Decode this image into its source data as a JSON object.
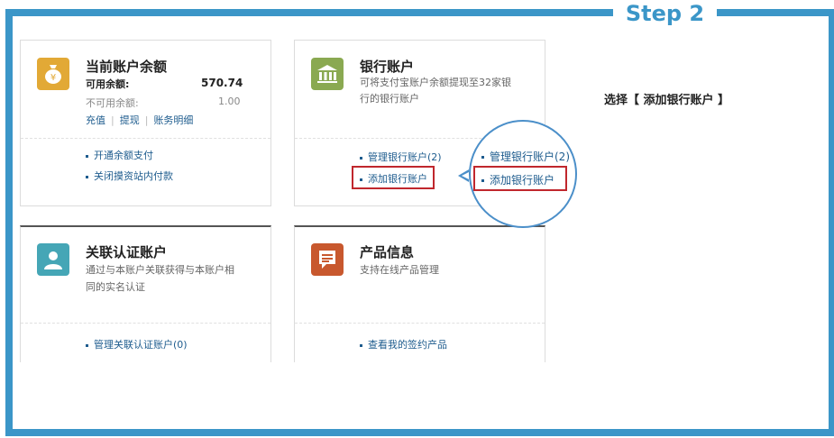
{
  "step_label": "Step 2",
  "instruction": "选择【 添加银行账户 】",
  "balance_card": {
    "title": "当前账户余额",
    "available_label": "可用余额:",
    "available_value": "570.74",
    "unavailable_label": "不可用余额:",
    "unavailable_value": "1.00",
    "actions": [
      "充值",
      "提现",
      "账务明细"
    ],
    "links": [
      "开通余额支付",
      "关闭摸资站内付款"
    ],
    "icon": "money-bag-icon",
    "icon_color": "#e2a936"
  },
  "bank_card": {
    "title": "银行账户",
    "desc_line1": "可将支付宝账户余额提现至32家银",
    "desc_line2": "行的银行账户",
    "links": [
      "管理银行账户(2)",
      "添加银行账户"
    ],
    "icon": "bank-icon",
    "icon_color": "#8aa951"
  },
  "zoom": {
    "links": [
      "管理银行账户(2)",
      "添加银行账户"
    ]
  },
  "verify_card": {
    "title": "关联认证账户",
    "desc_line1": "通过与本账户关联获得与本账户相",
    "desc_line2": "同的实名认证",
    "links": [
      "管理关联认证账户(0)"
    ],
    "icon": "user-icon",
    "icon_color": "#45a6b6"
  },
  "product_card": {
    "title": "产品信息",
    "desc_line1": "支持在线产品管理",
    "links": [
      "查看我的签约产品"
    ],
    "icon": "document-icon",
    "icon_color": "#c8582e"
  },
  "colors": {
    "accent": "#3b96c8",
    "highlight": "#c0272d",
    "link": "#1e5c8e"
  }
}
